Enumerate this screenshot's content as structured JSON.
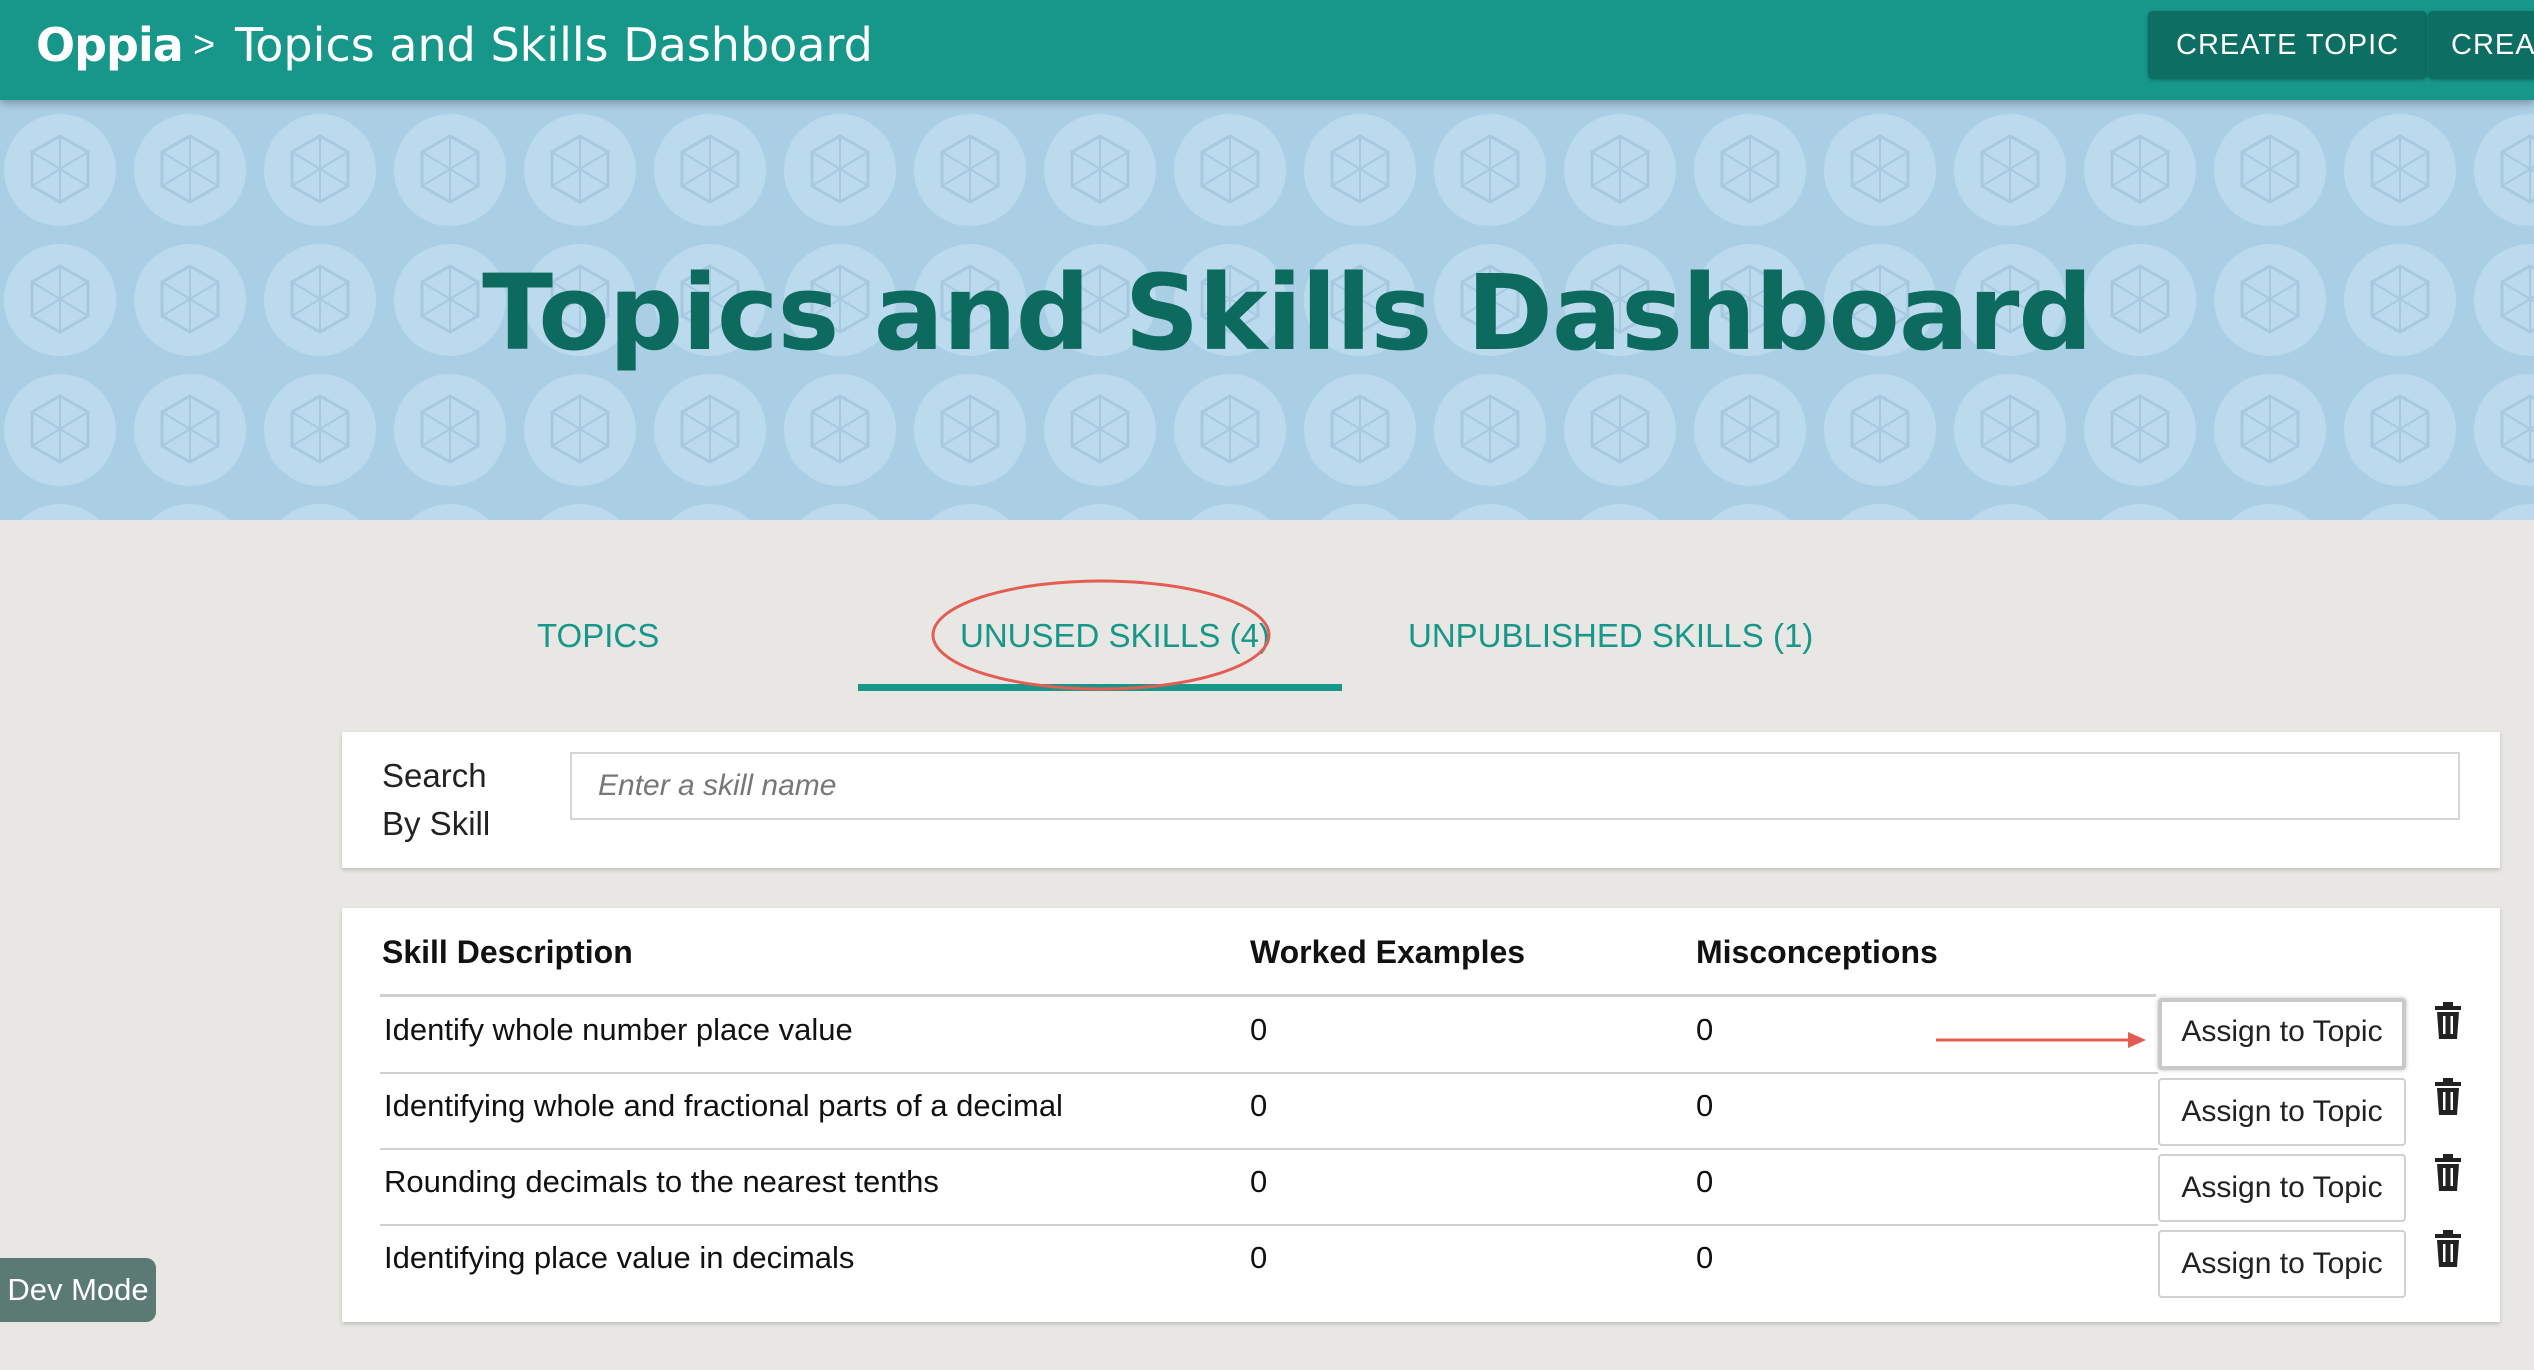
{
  "header": {
    "logo": "Oppia",
    "separator": ">",
    "breadcrumb_title": "Topics and Skills Dashboard",
    "buttons": [
      "CREATE TOPIC",
      "CREA"
    ]
  },
  "banner": {
    "title": "Topics and Skills Dashboard"
  },
  "tabs": [
    {
      "label": "TOPICS"
    },
    {
      "label": "UNUSED SKILLS (4)",
      "active": true
    },
    {
      "label": "UNPUBLISHED SKILLS (1)"
    }
  ],
  "search": {
    "label": "Search By Skill",
    "placeholder": "Enter a skill name"
  },
  "table": {
    "headers": [
      "Skill Description",
      "Worked Examples",
      "Misconceptions"
    ],
    "action_label": "Assign to Topic",
    "rows": [
      {
        "description": "Identify whole number place value",
        "worked_examples": "0",
        "misconceptions": "0"
      },
      {
        "description": "Identifying whole and fractional parts of a decimal",
        "worked_examples": "0",
        "misconceptions": "0"
      },
      {
        "description": "Rounding decimals to the nearest tenths",
        "worked_examples": "0",
        "misconceptions": "0"
      },
      {
        "description": "Identifying place value in decimals",
        "worked_examples": "0",
        "misconceptions": "0"
      }
    ]
  },
  "dev_mode": "Dev Mode",
  "colors": {
    "primary": "#16978a",
    "primary_dark": "#0d6e63",
    "banner_bg": "#aacfe4",
    "annotation_red": "#e35d52"
  },
  "icons": [
    "oppia-logo",
    "trash-icon",
    "annotation-arrow",
    "annotation-ellipse"
  ]
}
